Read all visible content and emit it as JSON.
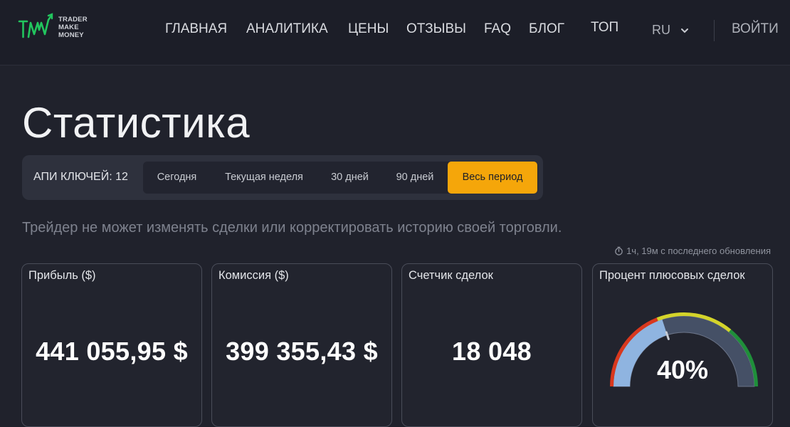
{
  "header": {
    "logo_lines": [
      "TRADER",
      "MAKE",
      "MONEY"
    ],
    "nav": [
      "ГЛАВНАЯ",
      "АНАЛИТИКА",
      "ЦЕНЫ",
      "ОТЗЫВЫ",
      "FAQ",
      "БЛОГ",
      "ТОП"
    ],
    "language": "RU",
    "login_label": "ВОЙТИ"
  },
  "page": {
    "title": "Статистика",
    "api_keys_label": "АПИ КЛЮЧЕЙ: 12",
    "periods": [
      "Сегодня",
      "Текущая неделя",
      "30 дней",
      "90 дней",
      "Весь период"
    ],
    "active_period": "Весь период",
    "disclaimer": "Трейдер не может изменять сделки или корректировать историю своей торговли.",
    "last_update": "1ч, 19м с последнего обновления"
  },
  "cards": [
    {
      "title": "Прибыль ($)",
      "value": "441 055,95 $"
    },
    {
      "title": "Комиссия ($)",
      "value": "399 355,43 $"
    },
    {
      "title": "Счетчик сделок",
      "value": "18 048"
    },
    {
      "title": "Процент плюсовых сделок",
      "value": "40%",
      "gauge_fraction": 0.4
    }
  ],
  "colors": {
    "accent": "#f5a60a",
    "logo_green": "#22c55e",
    "gauge_red": "#d9381e",
    "gauge_yellow": "#d4d42a",
    "gauge_green": "#1f8f3a",
    "gauge_fill": "#8fb4e0",
    "gauge_track": "#455066"
  }
}
